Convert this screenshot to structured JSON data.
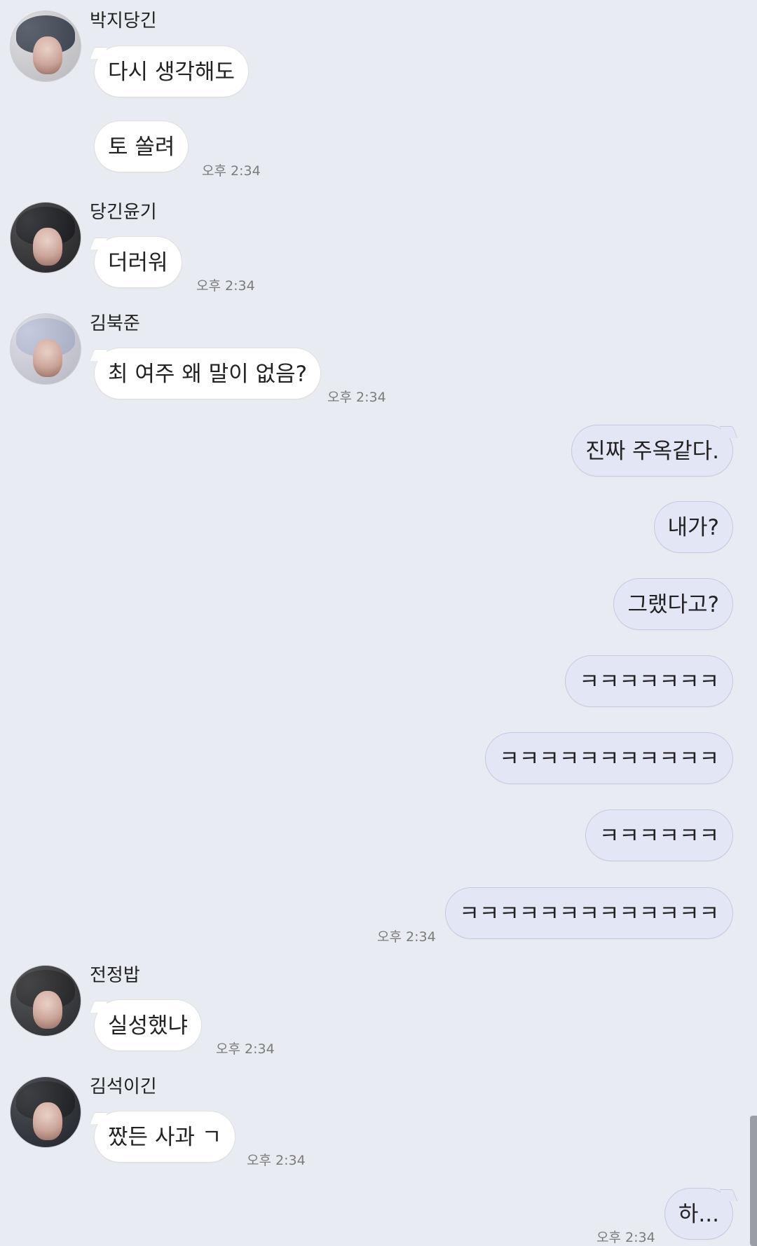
{
  "colors": {
    "background": "#e9ebf2",
    "incoming_bubble": "#ffffff",
    "outgoing_bubble": "#e3e6f5",
    "timestamp": "#7b7b7b"
  },
  "conversation": {
    "groups": [
      {
        "sender": "박지당긴",
        "messages": [
          "다시 생각해도",
          "토 쏠려"
        ],
        "time": "오후 2:34"
      },
      {
        "sender": "당긴윤기",
        "messages": [
          "더러워"
        ],
        "time": "오후 2:34"
      },
      {
        "sender": "김북준",
        "messages": [
          "최 여주 왜 말이 없음?"
        ],
        "time": "오후 2:34"
      },
      {
        "sender": "",
        "is_self": true,
        "messages": [
          "진짜 주옥같다.",
          "내가?",
          "그랬다고?",
          "ㅋㅋㅋㅋㅋㅋㅋ",
          "ㅋㅋㅋㅋㅋㅋㅋㅋㅋㅋㅋ",
          "ㅋㅋㅋㅋㅋㅋ",
          "ㅋㅋㅋㅋㅋㅋㅋㅋㅋㅋㅋㅋㅋ"
        ],
        "time": "오후 2:34"
      },
      {
        "sender": "전정밥",
        "messages": [
          "실성했냐"
        ],
        "time": "오후 2:34"
      },
      {
        "sender": "김석이긴",
        "messages": [
          "짰든 사과 ㄱ"
        ],
        "time": "오후 2:34"
      },
      {
        "sender": "",
        "is_self": true,
        "messages": [
          "하..."
        ],
        "time": "오후 2:34"
      }
    ]
  }
}
